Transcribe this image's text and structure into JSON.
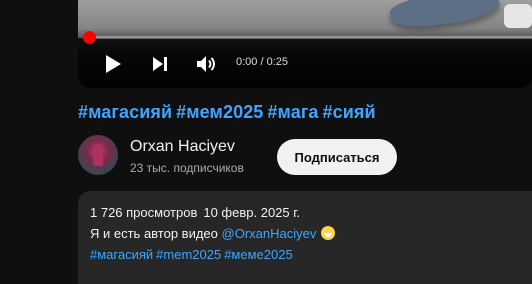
{
  "player": {
    "time_display": "0:00 / 0:25",
    "progress_fraction": 0.0
  },
  "video": {
    "title_tags": [
      "#магасияй",
      "#мем2025",
      "#мага",
      "#сияй"
    ]
  },
  "channel": {
    "name": "Orxan Haciyev",
    "subscribers": "23 тыс. подписчиков",
    "subscribe_label": "Подписаться"
  },
  "description": {
    "views": "1 726 просмотров",
    "date": "10 февр. 2025 г.",
    "text": "Я и есть автор видео",
    "mention": "@OrxanHaciyev",
    "tags": [
      "#магасияй",
      "#mem2025",
      "#меме2025"
    ]
  },
  "colors": {
    "accent_link": "#3ea6ff",
    "progress_red": "#ff0000",
    "background": "#0f0f0f",
    "description_bg": "#272727"
  },
  "icons": [
    "play-icon",
    "next-icon",
    "volume-icon",
    "emoji-icon"
  ]
}
